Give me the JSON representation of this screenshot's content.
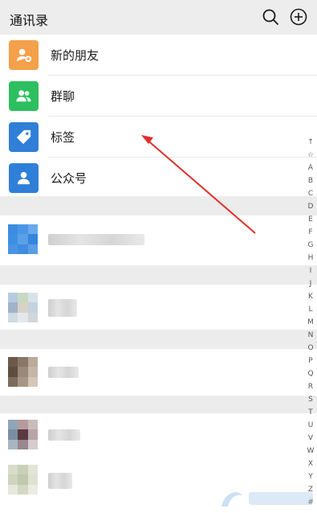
{
  "header": {
    "title": "通讯录"
  },
  "icons": {
    "search": "search-icon",
    "add": "plus-circle-icon"
  },
  "entries": [
    {
      "label": "新的朋友",
      "color": "#f5a04a",
      "icon": "add-friend-icon"
    },
    {
      "label": "群聊",
      "color": "#2dbf5f",
      "icon": "group-icon"
    },
    {
      "label": "标签",
      "color": "#2f7fd8",
      "icon": "tag-icon"
    },
    {
      "label": "公众号",
      "color": "#2f7fd8",
      "icon": "official-account-icon"
    }
  ],
  "index_bar": [
    "↑",
    "☆",
    "A",
    "B",
    "C",
    "D",
    "E",
    "F",
    "G",
    "H",
    "I",
    "J",
    "K",
    "L",
    "M",
    "N",
    "O",
    "P",
    "Q",
    "R",
    "S",
    "T",
    "U",
    "V",
    "W",
    "X",
    "Y",
    "Z",
    "#"
  ],
  "colors": {
    "header_bg": "#ededed",
    "section_band": "#ececec",
    "arrow": "#e0302a"
  }
}
